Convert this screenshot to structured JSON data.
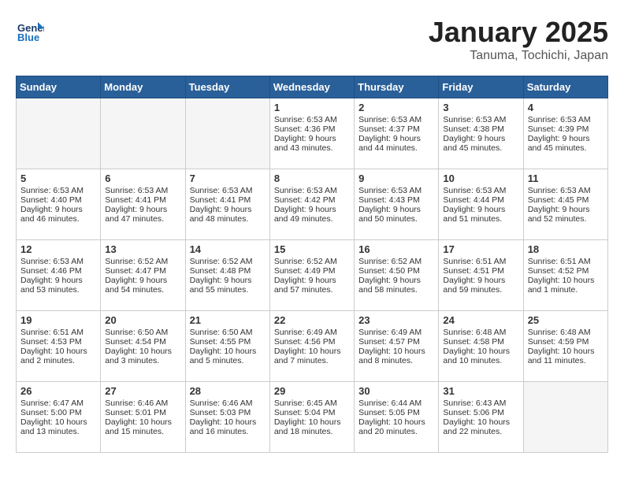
{
  "header": {
    "logo_general": "General",
    "logo_blue": "Blue",
    "month": "January 2025",
    "location": "Tanuma, Tochichi, Japan"
  },
  "days_of_week": [
    "Sunday",
    "Monday",
    "Tuesday",
    "Wednesday",
    "Thursday",
    "Friday",
    "Saturday"
  ],
  "weeks": [
    [
      {
        "day": "",
        "empty": true
      },
      {
        "day": "",
        "empty": true
      },
      {
        "day": "",
        "empty": true
      },
      {
        "day": "1",
        "sunrise": "6:53 AM",
        "sunset": "4:36 PM",
        "daylight": "9 hours and 43 minutes."
      },
      {
        "day": "2",
        "sunrise": "6:53 AM",
        "sunset": "4:37 PM",
        "daylight": "9 hours and 44 minutes."
      },
      {
        "day": "3",
        "sunrise": "6:53 AM",
        "sunset": "4:38 PM",
        "daylight": "9 hours and 45 minutes."
      },
      {
        "day": "4",
        "sunrise": "6:53 AM",
        "sunset": "4:39 PM",
        "daylight": "9 hours and 45 minutes."
      }
    ],
    [
      {
        "day": "5",
        "sunrise": "6:53 AM",
        "sunset": "4:40 PM",
        "daylight": "9 hours and 46 minutes."
      },
      {
        "day": "6",
        "sunrise": "6:53 AM",
        "sunset": "4:41 PM",
        "daylight": "9 hours and 47 minutes."
      },
      {
        "day": "7",
        "sunrise": "6:53 AM",
        "sunset": "4:41 PM",
        "daylight": "9 hours and 48 minutes."
      },
      {
        "day": "8",
        "sunrise": "6:53 AM",
        "sunset": "4:42 PM",
        "daylight": "9 hours and 49 minutes."
      },
      {
        "day": "9",
        "sunrise": "6:53 AM",
        "sunset": "4:43 PM",
        "daylight": "9 hours and 50 minutes."
      },
      {
        "day": "10",
        "sunrise": "6:53 AM",
        "sunset": "4:44 PM",
        "daylight": "9 hours and 51 minutes."
      },
      {
        "day": "11",
        "sunrise": "6:53 AM",
        "sunset": "4:45 PM",
        "daylight": "9 hours and 52 minutes."
      }
    ],
    [
      {
        "day": "12",
        "sunrise": "6:53 AM",
        "sunset": "4:46 PM",
        "daylight": "9 hours and 53 minutes."
      },
      {
        "day": "13",
        "sunrise": "6:52 AM",
        "sunset": "4:47 PM",
        "daylight": "9 hours and 54 minutes."
      },
      {
        "day": "14",
        "sunrise": "6:52 AM",
        "sunset": "4:48 PM",
        "daylight": "9 hours and 55 minutes."
      },
      {
        "day": "15",
        "sunrise": "6:52 AM",
        "sunset": "4:49 PM",
        "daylight": "9 hours and 57 minutes."
      },
      {
        "day": "16",
        "sunrise": "6:52 AM",
        "sunset": "4:50 PM",
        "daylight": "9 hours and 58 minutes."
      },
      {
        "day": "17",
        "sunrise": "6:51 AM",
        "sunset": "4:51 PM",
        "daylight": "9 hours and 59 minutes."
      },
      {
        "day": "18",
        "sunrise": "6:51 AM",
        "sunset": "4:52 PM",
        "daylight": "10 hours and 1 minute."
      }
    ],
    [
      {
        "day": "19",
        "sunrise": "6:51 AM",
        "sunset": "4:53 PM",
        "daylight": "10 hours and 2 minutes."
      },
      {
        "day": "20",
        "sunrise": "6:50 AM",
        "sunset": "4:54 PM",
        "daylight": "10 hours and 3 minutes."
      },
      {
        "day": "21",
        "sunrise": "6:50 AM",
        "sunset": "4:55 PM",
        "daylight": "10 hours and 5 minutes."
      },
      {
        "day": "22",
        "sunrise": "6:49 AM",
        "sunset": "4:56 PM",
        "daylight": "10 hours and 7 minutes."
      },
      {
        "day": "23",
        "sunrise": "6:49 AM",
        "sunset": "4:57 PM",
        "daylight": "10 hours and 8 minutes."
      },
      {
        "day": "24",
        "sunrise": "6:48 AM",
        "sunset": "4:58 PM",
        "daylight": "10 hours and 10 minutes."
      },
      {
        "day": "25",
        "sunrise": "6:48 AM",
        "sunset": "4:59 PM",
        "daylight": "10 hours and 11 minutes."
      }
    ],
    [
      {
        "day": "26",
        "sunrise": "6:47 AM",
        "sunset": "5:00 PM",
        "daylight": "10 hours and 13 minutes."
      },
      {
        "day": "27",
        "sunrise": "6:46 AM",
        "sunset": "5:01 PM",
        "daylight": "10 hours and 15 minutes."
      },
      {
        "day": "28",
        "sunrise": "6:46 AM",
        "sunset": "5:03 PM",
        "daylight": "10 hours and 16 minutes."
      },
      {
        "day": "29",
        "sunrise": "6:45 AM",
        "sunset": "5:04 PM",
        "daylight": "10 hours and 18 minutes."
      },
      {
        "day": "30",
        "sunrise": "6:44 AM",
        "sunset": "5:05 PM",
        "daylight": "10 hours and 20 minutes."
      },
      {
        "day": "31",
        "sunrise": "6:43 AM",
        "sunset": "5:06 PM",
        "daylight": "10 hours and 22 minutes."
      },
      {
        "day": "",
        "empty": true
      }
    ]
  ]
}
